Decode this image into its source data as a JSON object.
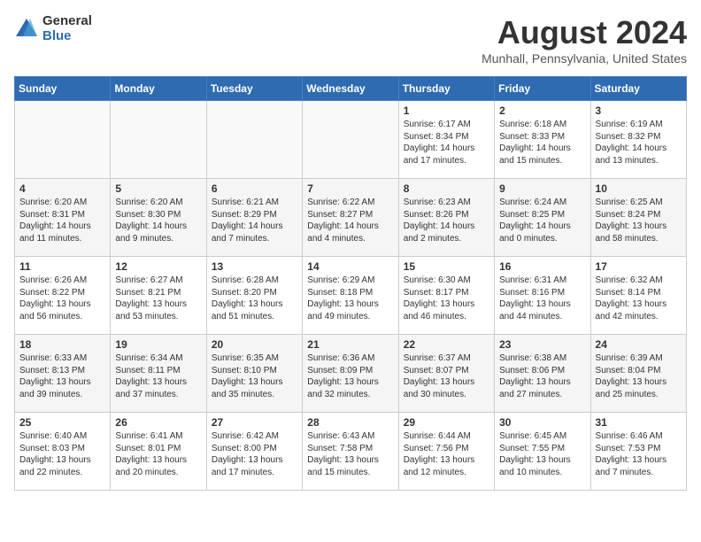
{
  "header": {
    "logo_general": "General",
    "logo_blue": "Blue",
    "month_title": "August 2024",
    "location": "Munhall, Pennsylvania, United States"
  },
  "days_of_week": [
    "Sunday",
    "Monday",
    "Tuesday",
    "Wednesday",
    "Thursday",
    "Friday",
    "Saturday"
  ],
  "weeks": [
    [
      {
        "day": "",
        "text": ""
      },
      {
        "day": "",
        "text": ""
      },
      {
        "day": "",
        "text": ""
      },
      {
        "day": "",
        "text": ""
      },
      {
        "day": "1",
        "text": "Sunrise: 6:17 AM\nSunset: 8:34 PM\nDaylight: 14 hours and 17 minutes."
      },
      {
        "day": "2",
        "text": "Sunrise: 6:18 AM\nSunset: 8:33 PM\nDaylight: 14 hours and 15 minutes."
      },
      {
        "day": "3",
        "text": "Sunrise: 6:19 AM\nSunset: 8:32 PM\nDaylight: 14 hours and 13 minutes."
      }
    ],
    [
      {
        "day": "4",
        "text": "Sunrise: 6:20 AM\nSunset: 8:31 PM\nDaylight: 14 hours and 11 minutes."
      },
      {
        "day": "5",
        "text": "Sunrise: 6:20 AM\nSunset: 8:30 PM\nDaylight: 14 hours and 9 minutes."
      },
      {
        "day": "6",
        "text": "Sunrise: 6:21 AM\nSunset: 8:29 PM\nDaylight: 14 hours and 7 minutes."
      },
      {
        "day": "7",
        "text": "Sunrise: 6:22 AM\nSunset: 8:27 PM\nDaylight: 14 hours and 4 minutes."
      },
      {
        "day": "8",
        "text": "Sunrise: 6:23 AM\nSunset: 8:26 PM\nDaylight: 14 hours and 2 minutes."
      },
      {
        "day": "9",
        "text": "Sunrise: 6:24 AM\nSunset: 8:25 PM\nDaylight: 14 hours and 0 minutes."
      },
      {
        "day": "10",
        "text": "Sunrise: 6:25 AM\nSunset: 8:24 PM\nDaylight: 13 hours and 58 minutes."
      }
    ],
    [
      {
        "day": "11",
        "text": "Sunrise: 6:26 AM\nSunset: 8:22 PM\nDaylight: 13 hours and 56 minutes."
      },
      {
        "day": "12",
        "text": "Sunrise: 6:27 AM\nSunset: 8:21 PM\nDaylight: 13 hours and 53 minutes."
      },
      {
        "day": "13",
        "text": "Sunrise: 6:28 AM\nSunset: 8:20 PM\nDaylight: 13 hours and 51 minutes."
      },
      {
        "day": "14",
        "text": "Sunrise: 6:29 AM\nSunset: 8:18 PM\nDaylight: 13 hours and 49 minutes."
      },
      {
        "day": "15",
        "text": "Sunrise: 6:30 AM\nSunset: 8:17 PM\nDaylight: 13 hours and 46 minutes."
      },
      {
        "day": "16",
        "text": "Sunrise: 6:31 AM\nSunset: 8:16 PM\nDaylight: 13 hours and 44 minutes."
      },
      {
        "day": "17",
        "text": "Sunrise: 6:32 AM\nSunset: 8:14 PM\nDaylight: 13 hours and 42 minutes."
      }
    ],
    [
      {
        "day": "18",
        "text": "Sunrise: 6:33 AM\nSunset: 8:13 PM\nDaylight: 13 hours and 39 minutes."
      },
      {
        "day": "19",
        "text": "Sunrise: 6:34 AM\nSunset: 8:11 PM\nDaylight: 13 hours and 37 minutes."
      },
      {
        "day": "20",
        "text": "Sunrise: 6:35 AM\nSunset: 8:10 PM\nDaylight: 13 hours and 35 minutes."
      },
      {
        "day": "21",
        "text": "Sunrise: 6:36 AM\nSunset: 8:09 PM\nDaylight: 13 hours and 32 minutes."
      },
      {
        "day": "22",
        "text": "Sunrise: 6:37 AM\nSunset: 8:07 PM\nDaylight: 13 hours and 30 minutes."
      },
      {
        "day": "23",
        "text": "Sunrise: 6:38 AM\nSunset: 8:06 PM\nDaylight: 13 hours and 27 minutes."
      },
      {
        "day": "24",
        "text": "Sunrise: 6:39 AM\nSunset: 8:04 PM\nDaylight: 13 hours and 25 minutes."
      }
    ],
    [
      {
        "day": "25",
        "text": "Sunrise: 6:40 AM\nSunset: 8:03 PM\nDaylight: 13 hours and 22 minutes."
      },
      {
        "day": "26",
        "text": "Sunrise: 6:41 AM\nSunset: 8:01 PM\nDaylight: 13 hours and 20 minutes."
      },
      {
        "day": "27",
        "text": "Sunrise: 6:42 AM\nSunset: 8:00 PM\nDaylight: 13 hours and 17 minutes."
      },
      {
        "day": "28",
        "text": "Sunrise: 6:43 AM\nSunset: 7:58 PM\nDaylight: 13 hours and 15 minutes."
      },
      {
        "day": "29",
        "text": "Sunrise: 6:44 AM\nSunset: 7:56 PM\nDaylight: 13 hours and 12 minutes."
      },
      {
        "day": "30",
        "text": "Sunrise: 6:45 AM\nSunset: 7:55 PM\nDaylight: 13 hours and 10 minutes."
      },
      {
        "day": "31",
        "text": "Sunrise: 6:46 AM\nSunset: 7:53 PM\nDaylight: 13 hours and 7 minutes."
      }
    ]
  ]
}
